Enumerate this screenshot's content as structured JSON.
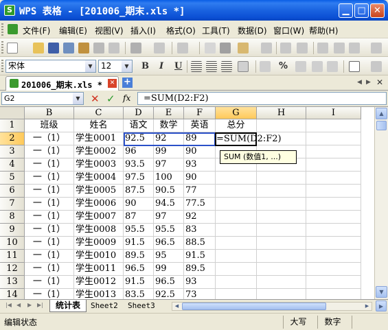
{
  "window": {
    "title": "WPS 表格 - [201006_期末.xls *]"
  },
  "menu": [
    "文件(F)",
    "编辑(E)",
    "视图(V)",
    "插入(I)",
    "格式(O)",
    "工具(T)",
    "数据(D)",
    "窗口(W)",
    "帮助(H)"
  ],
  "format_toolbar": {
    "font_name": "宋体",
    "font_size": "12",
    "bold": "B",
    "italic": "I",
    "underline": "U",
    "percent": "%"
  },
  "document_tab": {
    "label": "201006_期末.xls *"
  },
  "formula_bar": {
    "name_box": "G2",
    "cancel_glyph": "✕",
    "confirm_glyph": "✓",
    "fx_label": "fx",
    "formula": "=SUM(D2:F2)"
  },
  "columns": [
    "B",
    "C",
    "D",
    "E",
    "F",
    "G",
    "H",
    "I"
  ],
  "rows": [
    {
      "n": "1",
      "b": "班级",
      "c": "姓名",
      "d": "语文",
      "e": "数学",
      "f": "英语",
      "g": "总分"
    },
    {
      "n": "2",
      "b": "一（1）",
      "c": "学生0001",
      "d": "92.5",
      "e": "92",
      "f": "89",
      "g": ""
    },
    {
      "n": "3",
      "b": "一（1）",
      "c": "学生0002",
      "d": "96",
      "e": "99",
      "f": "90",
      "g": ""
    },
    {
      "n": "4",
      "b": "一（1）",
      "c": "学生0003",
      "d": "93.5",
      "e": "97",
      "f": "93",
      "g": ""
    },
    {
      "n": "5",
      "b": "一（1）",
      "c": "学生0004",
      "d": "97.5",
      "e": "100",
      "f": "90",
      "g": ""
    },
    {
      "n": "6",
      "b": "一（1）",
      "c": "学生0005",
      "d": "87.5",
      "e": "90.5",
      "f": "77",
      "g": ""
    },
    {
      "n": "7",
      "b": "一（1）",
      "c": "学生0006",
      "d": "90",
      "e": "94.5",
      "f": "77.5",
      "g": ""
    },
    {
      "n": "8",
      "b": "一（1）",
      "c": "学生0007",
      "d": "87",
      "e": "97",
      "f": "92",
      "g": ""
    },
    {
      "n": "9",
      "b": "一（1）",
      "c": "学生0008",
      "d": "95.5",
      "e": "95.5",
      "f": "83",
      "g": ""
    },
    {
      "n": "10",
      "b": "一（1）",
      "c": "学生0009",
      "d": "91.5",
      "e": "96.5",
      "f": "88.5",
      "g": ""
    },
    {
      "n": "11",
      "b": "一（1）",
      "c": "学生0010",
      "d": "89.5",
      "e": "95",
      "f": "91.5",
      "g": ""
    },
    {
      "n": "12",
      "b": "一（1）",
      "c": "学生0011",
      "d": "96.5",
      "e": "99",
      "f": "89.5",
      "g": ""
    },
    {
      "n": "13",
      "b": "一（1）",
      "c": "学生0012",
      "d": "91.5",
      "e": "96.5",
      "f": "93",
      "g": ""
    },
    {
      "n": "14",
      "b": "一（1）",
      "c": "学生0013",
      "d": "83.5",
      "e": "92.5",
      "f": "73",
      "g": ""
    }
  ],
  "active_cell": {
    "ref": "G2",
    "content": "=SUM(D2:F2)"
  },
  "tooltip": "SUM (数值1, ...)",
  "sheets": [
    "统计表",
    "Sheet2",
    "Sheet3"
  ],
  "status": {
    "mode": "编辑状态",
    "caps": "大写",
    "num": "数字"
  },
  "colors": {
    "title_bar": "#0a5ee6",
    "selection_header": "#ffc95a",
    "range_border": "#2a50c8",
    "tooltip_bg": "#ffffe1"
  }
}
